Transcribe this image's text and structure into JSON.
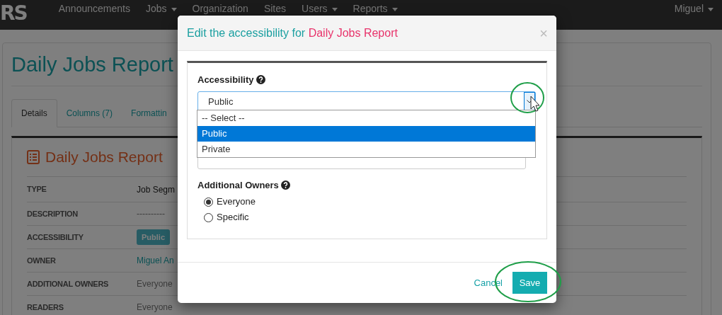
{
  "navbar": {
    "logo": "RS",
    "items": [
      {
        "label": "Announcements",
        "dropdown": false
      },
      {
        "label": "Jobs",
        "dropdown": true
      },
      {
        "label": "Organization",
        "dropdown": false
      },
      {
        "label": "Sites",
        "dropdown": false
      },
      {
        "label": "Users",
        "dropdown": true
      },
      {
        "label": "Reports",
        "dropdown": true
      }
    ],
    "user": "Miguel"
  },
  "page": {
    "title": "Daily Jobs Report",
    "tabs": [
      {
        "label": "Details",
        "selected": true
      },
      {
        "label": "Columns (7)",
        "selected": false
      },
      {
        "label": "Formattin",
        "selected": false
      }
    ],
    "panel_title": "Daily Jobs Report",
    "rows": [
      {
        "label": "TYPE",
        "value": "Job Segm",
        "kind": "text"
      },
      {
        "label": "DESCRIPTION",
        "value": "----------",
        "kind": "muted"
      },
      {
        "label": "ACCESSIBILITY",
        "value": "Public",
        "kind": "badge"
      },
      {
        "label": "OWNER",
        "value": "Miguel An",
        "kind": "link"
      },
      {
        "label": "ADDITIONAL OWNERS",
        "value": "Everyone",
        "kind": "muted"
      },
      {
        "label": "READERS",
        "value": "Everyone",
        "kind": "muted"
      }
    ]
  },
  "modal": {
    "title": "Edit the accessibility for",
    "title_name": "Daily Jobs Report",
    "close": "×",
    "accessibility": {
      "label": "Accessibility",
      "value": "Public",
      "options": [
        {
          "label": "-- Select --",
          "selected": false
        },
        {
          "label": "Public",
          "selected": true
        },
        {
          "label": "Private",
          "selected": false
        }
      ]
    },
    "additional_owners": {
      "label": "Additional Owners",
      "options": [
        {
          "label": "Everyone",
          "selected": true
        },
        {
          "label": "Specific",
          "selected": false
        }
      ]
    },
    "cancel": "Cancel",
    "save": "Save"
  }
}
